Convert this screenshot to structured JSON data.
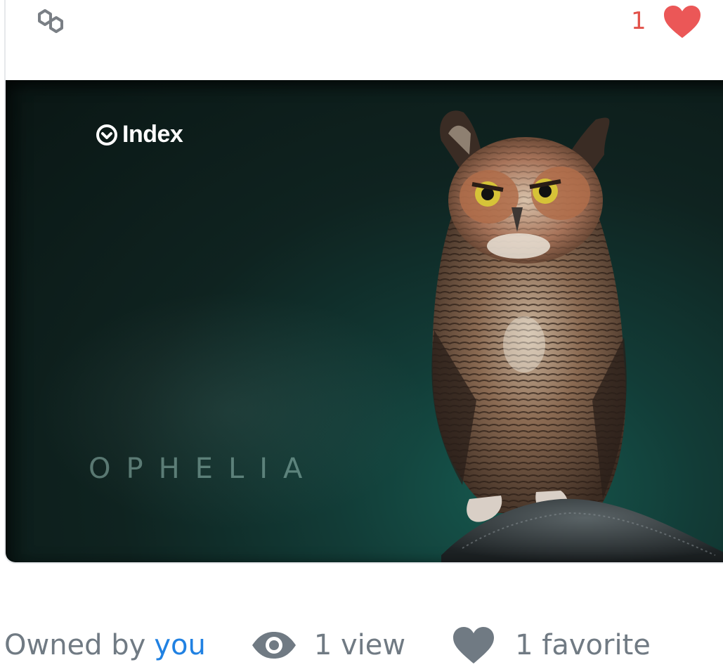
{
  "header": {
    "chain_icon": "polygon-icon",
    "favorite_count": "1",
    "favorite_icon": "heart-icon",
    "heart_color": "#eb5757"
  },
  "media": {
    "brand_icon": "index-logo-icon",
    "brand_name": "Index",
    "title": "OPHELIA",
    "subject": "owl"
  },
  "stats": {
    "owned_prefix": "Owned by",
    "owner": "you",
    "owner_color": "#2081e2",
    "views_icon": "eye-icon",
    "views": "1 view",
    "favorites_icon": "heart-icon",
    "favorites": "1 favorite",
    "text_color": "#707a83"
  }
}
